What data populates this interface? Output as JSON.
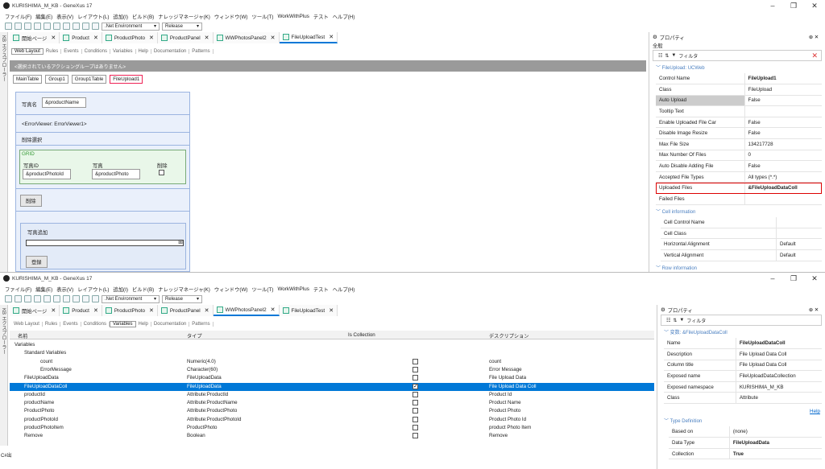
{
  "top": {
    "title": "KURISHIMA_M_KB - GeneXus 17",
    "menu": [
      "ファイル(F)",
      "編集(E)",
      "表示(V)",
      "レイアウト(L)",
      "追加(I)",
      "ビルド(B)",
      "ナレッジマネージャ(K)",
      "ウィンドウ(W)",
      "ツール(T)",
      "WorkWithPlus",
      "テスト",
      "ヘルプ(H)"
    ],
    "env": ".Net Environment",
    "config": "Release",
    "left_strip": "KB エクスプローラー",
    "tabs": [
      "開始ページ",
      "Product",
      "ProductPhoto",
      "ProductPanel",
      "WWPhotosPanel2",
      "FileUploadTest"
    ],
    "subtabs": [
      "Web Layout",
      "Rules",
      "Events",
      "Conditions",
      "Variables",
      "Help",
      "Documentation",
      "Patterns"
    ],
    "actionbar": "<選択されているアクショングループはありません>",
    "crumbs": [
      "MainTable",
      "Group1",
      "Group1Table",
      "FileUpload1"
    ],
    "form": {
      "photo_label": "写真名",
      "photo_field": "&productName",
      "error_viewer": "<ErrorViewer: ErrorViewer1>",
      "delete_select": "削除選択",
      "grid_title": "GRID",
      "col_photo_id": "写真ID",
      "col_photo": "写真",
      "col_delete": "削除",
      "val_photo_id": "&productPhotoId",
      "val_photo": "&productPhoto",
      "delete_btn": "削除",
      "add_photo": "写真追加",
      "register_btn": "登録"
    },
    "props": {
      "title": "プロパティ",
      "scope": "全般",
      "filter": "フィルタ",
      "group": "FileUpload: UCWeb",
      "rows": [
        [
          "Control Name",
          "FileUpload1"
        ],
        [
          "Class",
          "FileUpload"
        ],
        [
          "Auto Upload",
          "False"
        ],
        [
          "Tooltip Text",
          ""
        ],
        [
          "Enable Uploaded File Car",
          "False"
        ],
        [
          "Disable Image Resize",
          "False"
        ],
        [
          "Max File Size",
          "134217728"
        ],
        [
          "Max Number Of Files",
          "0"
        ],
        [
          "Auto Disable Adding File",
          "False"
        ],
        [
          "Accepted File Types",
          "All types (*.*)"
        ],
        [
          "Uploaded Files",
          "&FileUploadDataColl"
        ],
        [
          "Failed Files",
          ""
        ]
      ],
      "cell_group": "Cell information",
      "cell_rows": [
        [
          "Cell Control Name",
          ""
        ],
        [
          "Cell Class",
          ""
        ],
        [
          "Horizontal Alignment",
          "Default"
        ],
        [
          "Vertical Alignment",
          "Default"
        ]
      ],
      "row_group": "Row information"
    }
  },
  "bottom": {
    "title": "KURISHIMA_M_KB - GeneXus 17",
    "menu": [
      "ファイル(F)",
      "編集(E)",
      "表示(V)",
      "レイアウト(L)",
      "追加(I)",
      "ビルド(B)",
      "ナレッジマネージャ(K)",
      "ウィンドウ(W)",
      "ツール(T)",
      "WorkWithPlus",
      "テスト",
      "ヘルプ(H)"
    ],
    "env": ".Net Environment",
    "config": "Release",
    "left_strip": "KB エクスプローラー",
    "output_label": "C#出",
    "tabs": [
      "開始ページ",
      "Product",
      "ProductPhoto",
      "ProductPanel",
      "WWPhotosPanel2",
      "FileUploadTest"
    ],
    "subtabs": [
      "Web Layout",
      "Rules",
      "Events",
      "Conditions",
      "Variables",
      "Help",
      "Documentation",
      "Patterns"
    ],
    "columns": [
      "名前",
      "タイプ",
      "Is Collection",
      "デスクリプション"
    ],
    "rows": [
      {
        "name": "Variables",
        "type": "",
        "coll": null,
        "desc": "",
        "indent": 0
      },
      {
        "name": "Standard Variables",
        "type": "",
        "coll": null,
        "desc": "",
        "indent": 1
      },
      {
        "name": "count",
        "type": "Numeric(4.0)",
        "coll": false,
        "desc": "count",
        "indent": 2
      },
      {
        "name": "ErrorMessage",
        "type": "Character(60)",
        "coll": false,
        "desc": "Error Message",
        "indent": 2
      },
      {
        "name": "FileUploadData",
        "type": "FileUploadData",
        "coll": false,
        "desc": "File Upload Data",
        "indent": 1
      },
      {
        "name": "FileUploadDataColl",
        "type": "FileUploadData",
        "coll": true,
        "desc": "File Upload Data Coll",
        "indent": 1,
        "selected": true
      },
      {
        "name": "productId",
        "type": "Attribute:ProductId",
        "coll": false,
        "desc": "Product Id",
        "indent": 1
      },
      {
        "name": "productName",
        "type": "Attribute:ProductName",
        "coll": false,
        "desc": "Product Name",
        "indent": 1
      },
      {
        "name": "ProductPhoto",
        "type": "Attribute:ProductPhoto",
        "coll": false,
        "desc": "Product Photo",
        "indent": 1
      },
      {
        "name": "productPhotoId",
        "type": "Attribute:ProductPhotoId",
        "coll": false,
        "desc": "Product Photo Id",
        "indent": 1
      },
      {
        "name": "productPhotoItem",
        "type": "ProductPhoto",
        "coll": false,
        "desc": "product Photo Item",
        "indent": 1
      },
      {
        "name": "Remove",
        "type": "Boolean",
        "coll": false,
        "desc": "Remove",
        "indent": 1
      }
    ],
    "props": {
      "title": "プロパティ",
      "filter": "フィルタ",
      "group": "変数: &FileUploadDataColl",
      "rows": [
        [
          "Name",
          "FileUploadDataColl"
        ],
        [
          "Description",
          "File Upload Data Coll"
        ],
        [
          "Column title",
          "File Upload Data Coll"
        ],
        [
          "Exposed name",
          "FileUploadDataCollection"
        ],
        [
          "Exposed namespace",
          "KURISHIMA_M_KB"
        ],
        [
          "Class",
          "Attribute"
        ]
      ],
      "help": "Help",
      "type_group": "Type Definition",
      "type_rows": [
        [
          "Based on",
          "(none)"
        ],
        [
          "Data Type",
          "FileUploadData"
        ],
        [
          "Collection",
          "True"
        ]
      ]
    }
  }
}
